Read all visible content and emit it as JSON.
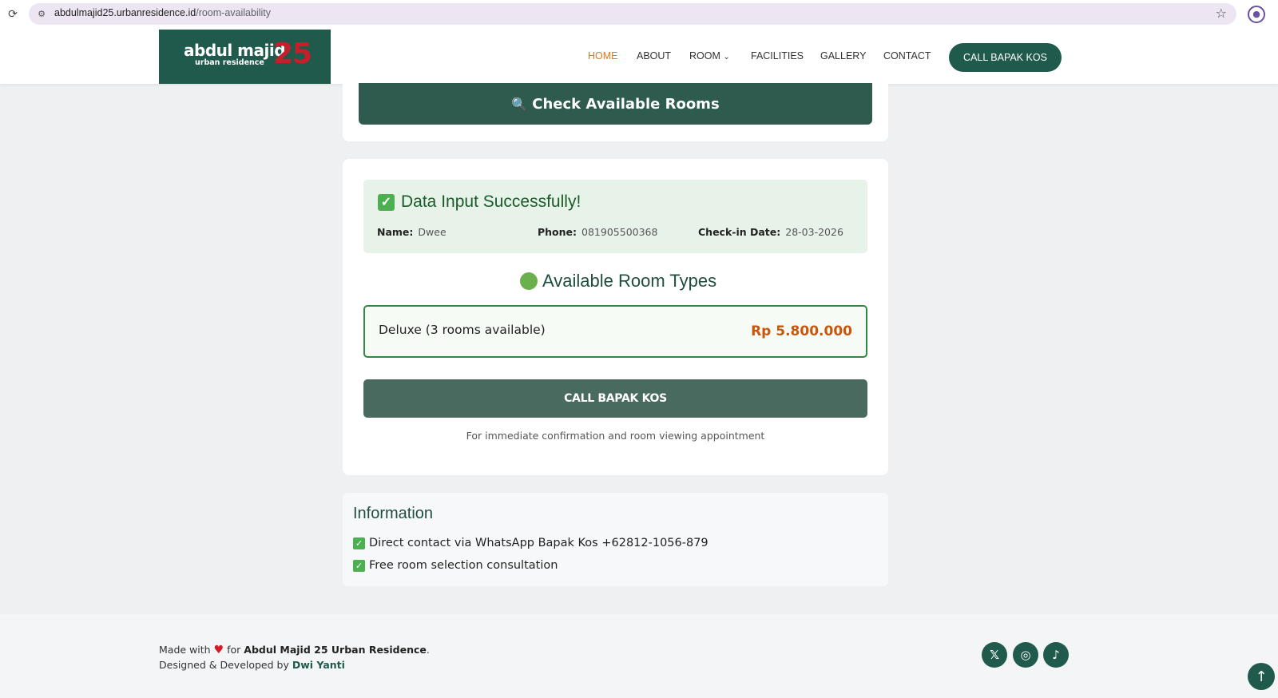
{
  "browser": {
    "url_host": "abdulmajid25.urbanresidence.id",
    "url_path": "/room-availability"
  },
  "header": {
    "logo": {
      "name": "abdul majid",
      "sub": "urban residence",
      "number": "25"
    },
    "nav": [
      {
        "label": "HOME",
        "active": true
      },
      {
        "label": "ABOUT"
      },
      {
        "label": "ROOM"
      },
      {
        "label": "FACILITIES"
      },
      {
        "label": "GALLERY"
      },
      {
        "label": "CONTACT"
      }
    ],
    "cta": "CALL BAPAK KOS"
  },
  "search": {
    "button_label": "Check Available Rooms"
  },
  "result": {
    "title": "Data Input Successfully!",
    "name_label": "Name:",
    "name_value": "Dwee",
    "phone_label": "Phone:",
    "phone_value": "081905500368",
    "checkin_label": "Check-in Date:",
    "checkin_value": "28-03-2026",
    "available_title": "Available Room Types",
    "rooms": [
      {
        "name": "Deluxe (3 rooms available)",
        "price": "Rp 5.800.000"
      }
    ],
    "call_button": "CALL BAPAK KOS",
    "note": "For immediate confirmation and room viewing appointment"
  },
  "information": {
    "title": "Information",
    "items": [
      "Direct contact via WhatsApp Bapak Kos +62812-1056-879",
      "Free room selection consultation"
    ]
  },
  "footer": {
    "made_with": "Made with",
    "for": "for",
    "brand": "Abdul Majid 25 Urban Residence",
    "designed_by": "Designed & Developed by",
    "developer": "Dwi Yanti",
    "social": [
      "x-icon",
      "instagram-icon",
      "tiktok-icon"
    ]
  },
  "colors": {
    "primary": "#1f5a4c",
    "accent": "#e07a17",
    "price": "#c9570b",
    "success": "#4caf50"
  }
}
